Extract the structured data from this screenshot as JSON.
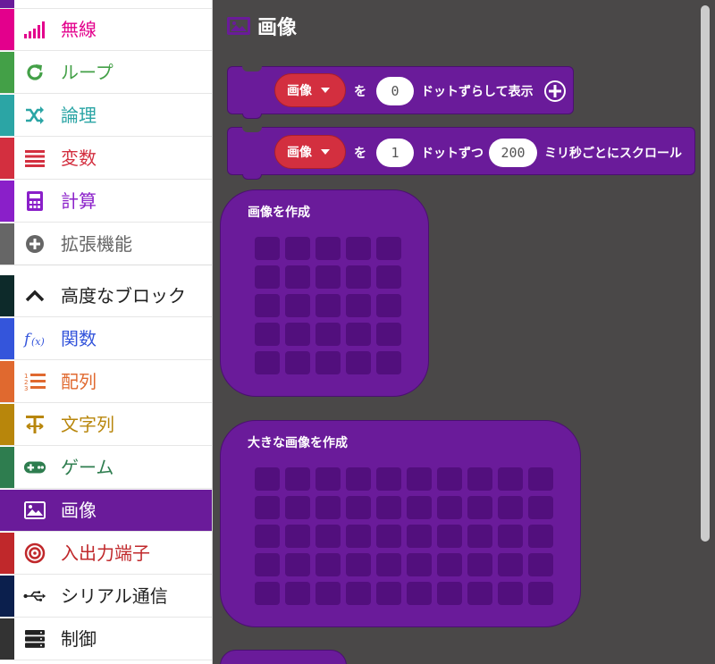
{
  "sidebar": {
    "categories": [
      {
        "id": "radio",
        "label": "無線",
        "icon": "signal-bars-icon",
        "color": "#e3008c"
      },
      {
        "id": "loops",
        "label": "ループ",
        "icon": "refresh-icon",
        "color": "#43a047"
      },
      {
        "id": "logic",
        "label": "論理",
        "icon": "shuffle-icon",
        "color": "#2ba5a5"
      },
      {
        "id": "variables",
        "label": "変数",
        "icon": "list-lines-icon",
        "color": "#d32f3f"
      },
      {
        "id": "math",
        "label": "計算",
        "icon": "calculator-icon",
        "color": "#8a1fc9"
      },
      {
        "id": "extensions",
        "label": "拡張機能",
        "icon": "plus-circle-icon",
        "color": "#666666"
      },
      {
        "id": "advanced",
        "label": "高度なブロック",
        "icon": "chevron-up-icon",
        "color": "#222222"
      },
      {
        "id": "functions",
        "label": "関数",
        "icon": "function-icon",
        "color": "#3455db"
      },
      {
        "id": "arrays",
        "label": "配列",
        "icon": "numbered-list-icon",
        "color": "#e0692f"
      },
      {
        "id": "text",
        "label": "文字列",
        "icon": "text-icon",
        "color": "#b8860b"
      },
      {
        "id": "game",
        "label": "ゲーム",
        "icon": "gamepad-icon",
        "color": "#2e7d4f"
      },
      {
        "id": "images",
        "label": "画像",
        "icon": "image-icon",
        "color": "#ffffff"
      },
      {
        "id": "pins",
        "label": "入出力端子",
        "icon": "target-icon",
        "color": "#c0282b"
      },
      {
        "id": "serial",
        "label": "シリアル通信",
        "icon": "usb-icon",
        "color": "#0b1f4d"
      },
      {
        "id": "control",
        "label": "制御",
        "icon": "server-icon",
        "color": "#222222"
      }
    ],
    "selected": "images"
  },
  "flyout": {
    "title": "画像",
    "block_show": {
      "dropdown": "画像",
      "word_wo": "を",
      "offset": "0",
      "text": "ドットずらして表示"
    },
    "block_scroll": {
      "dropdown": "画像",
      "word_wo": "を",
      "step": "1",
      "text_mid": "ドットずつ",
      "interval": "200",
      "text_end": "ミリ秒ごとにスクロール"
    },
    "block_create": {
      "title": "画像を作成",
      "rows": 5,
      "cols": 5
    },
    "block_create_big": {
      "title": "大きな画像を作成",
      "rows": 5,
      "cols": 10
    }
  },
  "colors": {
    "accent": "#6a1b9a",
    "flyout_bg": "#4a4848",
    "dropdown": "#d32f3f"
  }
}
